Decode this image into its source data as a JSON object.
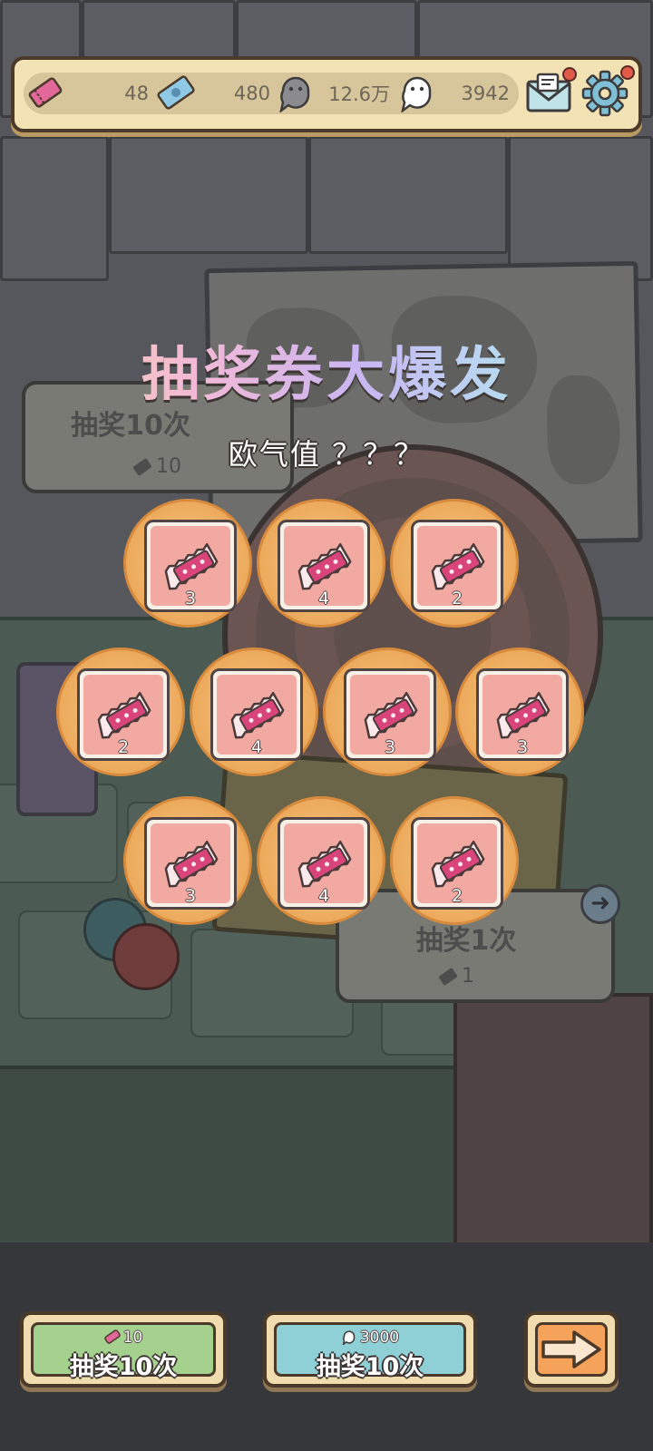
{
  "colors": {
    "topbar_bg": "#f3e2b4",
    "reward_orb": "#eeaf62",
    "ticket_pink": "#d9457a",
    "green_button": "#a5d18e",
    "blue_button": "#8fd0d6",
    "orange_button": "#f5a35a"
  },
  "resources": [
    {
      "icon": "pink-ticket-icon",
      "value": "48"
    },
    {
      "icon": "blue-ticket-icon",
      "value": "480"
    },
    {
      "icon": "gray-ghost-icon",
      "value": "12.6万"
    },
    {
      "icon": "white-ghost-icon",
      "value": "3942"
    }
  ],
  "top_buttons": [
    {
      "icon": "mail-icon",
      "has_badge": true
    },
    {
      "icon": "gear-icon",
      "has_badge": true
    }
  ],
  "background_signs": {
    "left": {
      "title": "抽奖10次",
      "cost": "10"
    },
    "right": {
      "title": "抽奖1次",
      "cost": "1"
    }
  },
  "popup": {
    "title": "抽奖券大爆发",
    "luck_label": "欧气值 ？？？",
    "rewards": [
      {
        "icon": "pink-ticket-icon",
        "count": "3"
      },
      {
        "icon": "pink-ticket-icon",
        "count": "4"
      },
      {
        "icon": "pink-ticket-icon",
        "count": "2"
      },
      {
        "icon": "pink-ticket-icon",
        "count": "2"
      },
      {
        "icon": "pink-ticket-icon",
        "count": "4"
      },
      {
        "icon": "pink-ticket-icon",
        "count": "3"
      },
      {
        "icon": "pink-ticket-icon",
        "count": "3"
      },
      {
        "icon": "pink-ticket-icon",
        "count": "3"
      },
      {
        "icon": "pink-ticket-icon",
        "count": "4"
      },
      {
        "icon": "pink-ticket-icon",
        "count": "2"
      }
    ]
  },
  "bottom_buttons": {
    "ticket_draw": {
      "cost_icon": "pink-ticket-icon",
      "cost": "10",
      "label": "抽奖10次"
    },
    "ghost_draw": {
      "cost_icon": "white-ghost-icon",
      "cost": "3000",
      "label": "抽奖10次"
    },
    "next": {
      "icon": "arrow-right-icon"
    }
  }
}
